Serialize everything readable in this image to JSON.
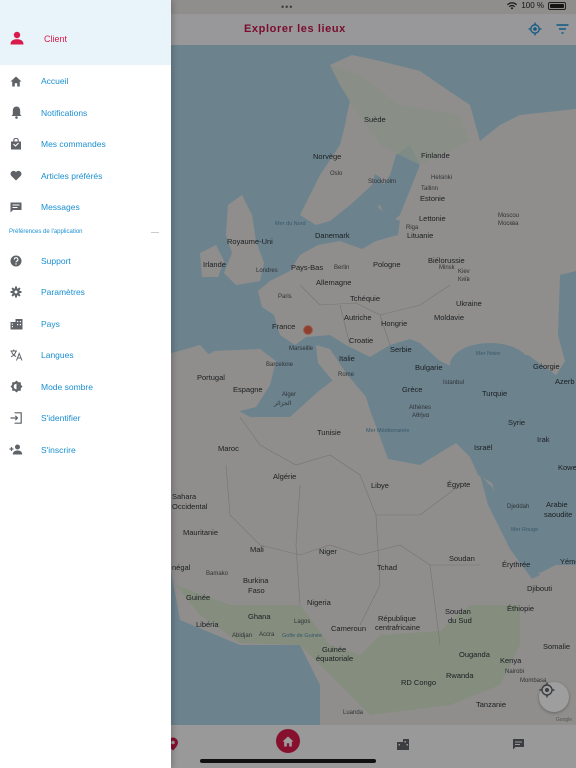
{
  "status_bar": {
    "dots": "•••",
    "battery_text": "100 %"
  },
  "header": {
    "title": "Explorer les lieux",
    "locate_icon": "target-icon",
    "filter_icon": "filter-icon"
  },
  "drawer": {
    "profile_label": "Client",
    "items_top": [
      {
        "label": "Accueil",
        "icon": "home-icon"
      },
      {
        "label": "Notifications",
        "icon": "bell-icon"
      },
      {
        "label": "Mes commandes",
        "icon": "bag-icon"
      },
      {
        "label": "Articles préférés",
        "icon": "heart-icon"
      },
      {
        "label": "Messages",
        "icon": "message-icon"
      }
    ],
    "section_title": "Préférences de l'application",
    "items_bottom": [
      {
        "label": "Support",
        "icon": "help-icon"
      },
      {
        "label": "Paramètres",
        "icon": "gear-icon"
      },
      {
        "label": "Pays",
        "icon": "city-icon"
      },
      {
        "label": "Langues",
        "icon": "translate-icon"
      },
      {
        "label": "Mode sombre",
        "icon": "brightness-icon"
      },
      {
        "label": "S'identifier",
        "icon": "login-icon"
      },
      {
        "label": "S'inscrire",
        "icon": "add-user-icon"
      }
    ]
  },
  "map": {
    "labels": {
      "suede": "Suède",
      "norvege": "Norvège",
      "finlande": "Finlande",
      "oslo": "Oslo",
      "stockholm": "Stockholm",
      "helsinki": "Helsinki",
      "tallinn": "Tallinn",
      "estonie": "Estonie",
      "lettonie": "Lettonie",
      "riga": "Riga",
      "mer_du_nord": "Mer du Nord",
      "danemark": "Danemark",
      "lituanie": "Lituanie",
      "royaume_uni": "Royaume-Uni",
      "irlande": "Irlande",
      "londres": "Londres",
      "pays_bas": "Pays-Bas",
      "berlin": "Berlin",
      "pologne": "Pologne",
      "bielorussie": "Biélorussie",
      "minsk": "Minsk",
      "moscou": "Moscou",
      "moscou_ar": "Москва",
      "allemagne": "Allemagne",
      "kiev": "Kiev",
      "kiev_ar": "Київ",
      "ukraine": "Ukraine",
      "paris": "Paris",
      "tcheque": "Tchéquie",
      "france": "France",
      "autriche": "Autriche",
      "hongrie": "Hongrie",
      "moldavie": "Moldavie",
      "croatie": "Croatie",
      "serbie": "Serbie",
      "marseille": "Marseille",
      "italie": "Italie",
      "mer_noire": "Mer Noire",
      "georgie": "Géorgie",
      "portugal": "Portugal",
      "barcelone": "Barcelone",
      "espagne": "Espagne",
      "bulgarie": "Bulgarie",
      "istanbul": "Istanbul",
      "azerb": "Azerb",
      "turquie": "Turquie",
      "rome": "Rome",
      "grece": "Grèce",
      "athenes": "Athènes",
      "athenes_gr": "Αθήνα",
      "alger": "Alger",
      "alger_ar": "الجزائر",
      "tunisie": "Tunisie",
      "mer_med": "Mer Méditerranée",
      "syrie": "Syrie",
      "maroc": "Maroc",
      "israel": "Israël",
      "irak": "Irak",
      "kowe": "Kowe",
      "algerie": "Algérie",
      "libye": "Libye",
      "egypte": "Égypte",
      "sahara": "Sahara",
      "occidental": "Occidental",
      "arabie": "Arabie",
      "saoudite": "saoudite",
      "mauritanie": "Mauritanie",
      "djeddah": "Djeddah",
      "mer_rouge": "Mer Rouge",
      "mali": "Mali",
      "niger": "Niger",
      "soudan": "Soudan",
      "tchad": "Tchad",
      "senegal": "négal",
      "erythree": "Érythrée",
      "yemen": "Yéme",
      "bamako": "Bamako",
      "burkina": "Burkina",
      "faso": "Faso",
      "djibouti": "Djibouti",
      "guinee": "Guinée",
      "nigeria": "Nigeria",
      "ethiopie": "Éthiopie",
      "ghana": "Ghana",
      "liberia": "Libéria",
      "lagos": "Lagos",
      "cameroun": "Cameroun",
      "rep_centr": "République",
      "centrafricaine": "centrafricaine",
      "soudan_sud": "Soudan",
      "du_sud": "du Sud",
      "somalie": "Somalie",
      "abidjan": "Abidjan",
      "accra": "Accra",
      "golfe": "Golfe de Guinée",
      "guinee_eq": "Guinée",
      "equatoriale": "équatoriale",
      "ouganda": "Ouganda",
      "kenya": "Kenya",
      "rwanda": "Rwanda",
      "rd_congo": "RD Congo",
      "nairobi": "Nairobi",
      "mombasa": "Mombasa",
      "tanzanie": "Tanzanie",
      "luanda": "Luanda"
    },
    "gps_icon": "gps-icon",
    "credit": "Google"
  },
  "tabs": [
    {
      "name": "map",
      "icon": "map-pin-icon"
    },
    {
      "name": "home",
      "icon": "home-icon"
    },
    {
      "name": "stores",
      "icon": "store-icon"
    },
    {
      "name": "chat",
      "icon": "chat-icon"
    }
  ],
  "colors": {
    "accent": "#d81b4a",
    "link": "#1a8fd1",
    "map_water": "#aed3e5",
    "map_land": "#e8e6e3"
  }
}
